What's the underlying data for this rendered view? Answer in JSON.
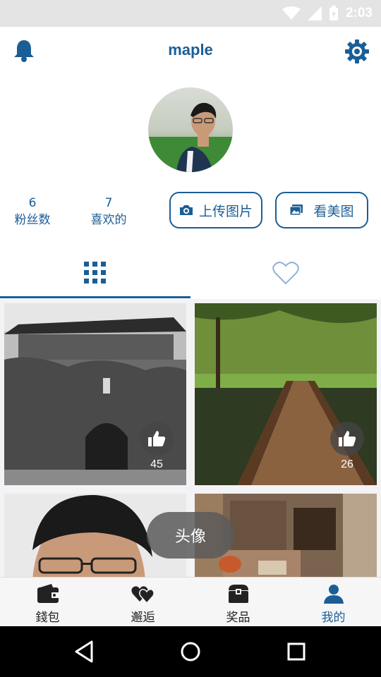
{
  "status_bar": {
    "time": "2:03"
  },
  "header": {
    "title": "maple"
  },
  "profile": {
    "followers_count": "6",
    "followers_label": "粉丝数",
    "likes_count": "7",
    "likes_label": "喜欢的"
  },
  "actions": {
    "upload_label": "上传图片",
    "view_label": "看美图"
  },
  "tabs": [
    {
      "name": "grid",
      "icon": "grid-icon",
      "active": true
    },
    {
      "name": "favorites",
      "icon": "heart-outline-icon",
      "active": false
    }
  ],
  "feed": [
    {
      "likes": "45"
    },
    {
      "likes": "26"
    },
    {},
    {}
  ],
  "toast": {
    "text": "头像"
  },
  "bottom_nav": [
    {
      "label": "錢包",
      "icon": "wallet-icon"
    },
    {
      "label": "邂逅",
      "icon": "hearts-icon"
    },
    {
      "label": "奖品",
      "icon": "treasure-chest-icon"
    },
    {
      "label": "我的",
      "icon": "person-icon",
      "active": true
    }
  ],
  "colors": {
    "accent": "#1b5e96",
    "status_bar": "#e4e4e4",
    "feed_bg": "#f3f3f5"
  }
}
